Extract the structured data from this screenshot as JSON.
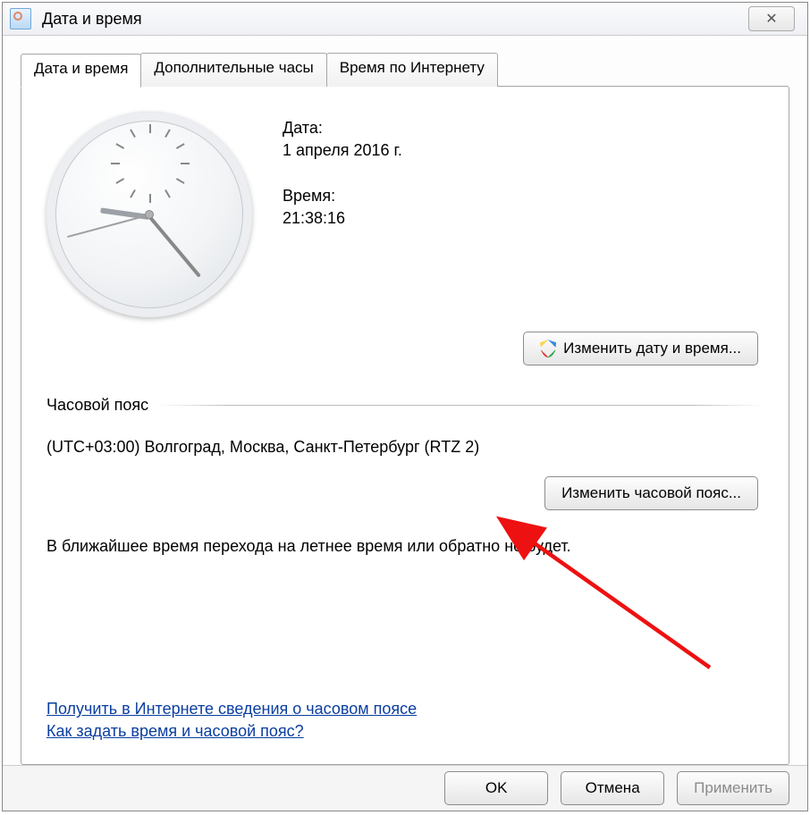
{
  "window": {
    "title": "Дата и время",
    "close_glyph": "✕"
  },
  "tabs": [
    {
      "label": "Дата и время"
    },
    {
      "label": "Дополнительные часы"
    },
    {
      "label": "Время по Интернету"
    }
  ],
  "date_section": {
    "date_label": "Дата:",
    "date_value": "1 апреля 2016 г.",
    "time_label": "Время:",
    "time_value": "21:38:16"
  },
  "buttons": {
    "change_date_time": "Изменить дату и время...",
    "change_timezone": "Изменить часовой пояс..."
  },
  "timezone": {
    "heading": "Часовой пояс",
    "value": "(UTC+03:00) Волгоград, Москва, Санкт-Петербург (RTZ 2)"
  },
  "dst_note": "В ближайшее время перехода на летнее время или обратно не будет.",
  "links": {
    "tz_info": "Получить в Интернете сведения о часовом поясе",
    "howto": "Как задать время и часовой пояс?"
  },
  "footer": {
    "ok": "OK",
    "cancel": "Отмена",
    "apply": "Применить"
  }
}
